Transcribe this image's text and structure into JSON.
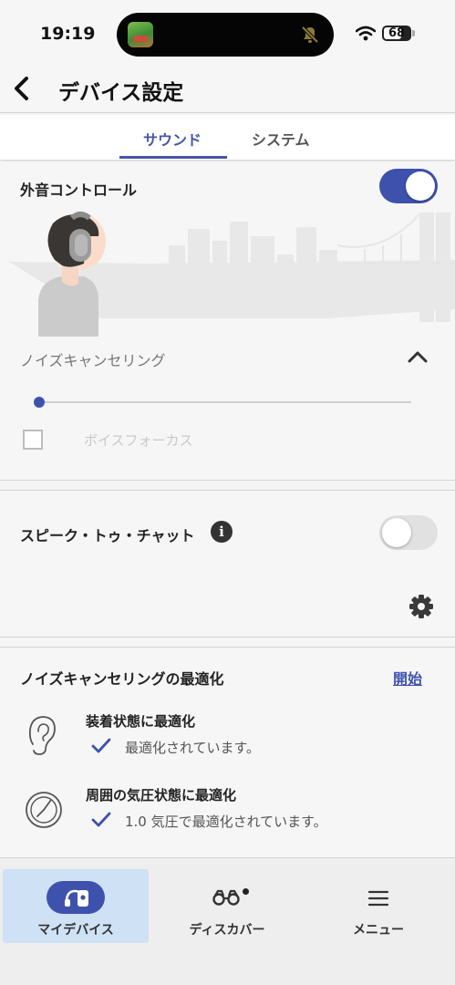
{
  "status_bar": {
    "time": "19:19",
    "battery": "68",
    "battery_level_percent": 68
  },
  "header": {
    "title": "デバイス設定"
  },
  "tabs": [
    {
      "label": "サウンド",
      "active": true
    },
    {
      "label": "システム",
      "active": false
    }
  ],
  "ambient": {
    "title": "外音コントロール",
    "enabled": true,
    "mode_label": "ノイズキャンセリング",
    "level_fraction": 0.0,
    "voice_focus_label": "ボイスフォーカス",
    "voice_focus_checked": false
  },
  "speak_to_chat": {
    "title": "スピーク・トゥ・チャット",
    "enabled": false
  },
  "nc_optimizer": {
    "title": "ノイズキャンセリングの最適化",
    "start_label": "開始",
    "items": [
      {
        "title": "装着状態に最適化",
        "status": "最適化されています。"
      },
      {
        "title": "周囲の気圧状態に最適化",
        "status": "1.0 気圧で最適化されています。"
      }
    ]
  },
  "bottom_nav": {
    "items": [
      {
        "label": "マイデバイス",
        "icon": "headphones-icon",
        "active": true
      },
      {
        "label": "ディスカバー",
        "icon": "binoculars-icon",
        "active": false
      },
      {
        "label": "メニュー",
        "icon": "hamburger-menu-icon",
        "active": false
      }
    ]
  },
  "colors": {
    "accent": "#3e52ad",
    "nav_active_bg": "#cfe1f5"
  }
}
